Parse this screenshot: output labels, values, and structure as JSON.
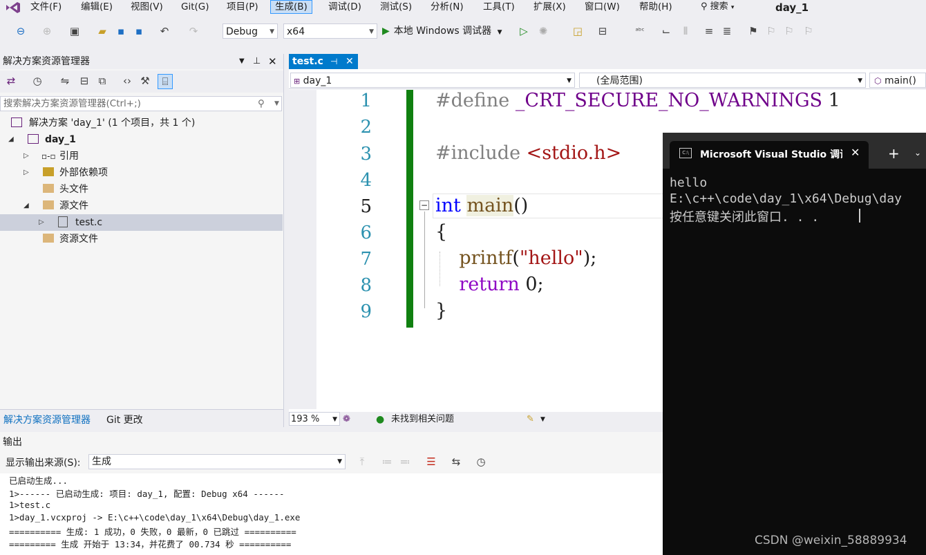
{
  "menu": {
    "items": [
      "文件(F)",
      "编辑(E)",
      "视图(V)",
      "Git(G)",
      "项目(P)",
      "生成(B)",
      "调试(D)",
      "测试(S)",
      "分析(N)",
      "工具(T)",
      "扩展(X)",
      "窗口(W)",
      "帮助(H)"
    ],
    "active_index": 5,
    "search_label": "搜索",
    "title": "day_1"
  },
  "toolbar": {
    "config": "Debug",
    "platform": "x64",
    "run_label": "本地 Windows 调试器"
  },
  "solution_explorer": {
    "title": "解决方案资源管理器",
    "search_placeholder": "搜索解决方案资源管理器(Ctrl+;)",
    "tree": [
      {
        "label": "解决方案 'day_1' (1 个项目，共 1 个)"
      },
      {
        "label": "day_1"
      },
      {
        "label": "引用"
      },
      {
        "label": "外部依赖项"
      },
      {
        "label": "头文件"
      },
      {
        "label": "源文件"
      },
      {
        "label": "test.c"
      },
      {
        "label": "资源文件"
      }
    ],
    "tabs": [
      "解决方案资源管理器",
      "Git 更改"
    ]
  },
  "editor": {
    "tab_label": "test.c",
    "nav": {
      "project": "day_1",
      "scope": "(全局范围)",
      "member": "main()"
    },
    "line_numbers": [
      "1",
      "2",
      "3",
      "4",
      "5",
      "6",
      "7",
      "8",
      "9"
    ],
    "code": {
      "l1_directive": "#define",
      "l1_macro": "_CRT_SECURE_NO_WARNINGS",
      "l1_value": "1",
      "l3_directive": "#include",
      "l3_header": "<stdio.h>",
      "l5_type": "int",
      "l5_name": "main",
      "l5_parens": "()",
      "l6": "{",
      "l7_fn": "printf",
      "l7_open": "(",
      "l7_str": "\"hello\"",
      "l7_close": ");",
      "l8_kw": "return",
      "l8_rest": "0;",
      "l9": "}"
    },
    "zoom": "193 %",
    "status": "未找到相关问题"
  },
  "output": {
    "title": "输出",
    "source_label": "显示输出来源(S):",
    "source_value": "生成",
    "lines": [
      "已启动生成...",
      "1>------ 已启动生成: 项目: day_1, 配置: Debug x64 ------",
      "1>test.c",
      "1>day_1.vcxproj -> E:\\c++\\code\\day_1\\x64\\Debug\\day_1.exe",
      "========== 生成: 1 成功，0 失败，0 最新，0 已跳过 ==========",
      "========= 生成 开始于 13:34，并花费了 00.734 秒 =========="
    ]
  },
  "console": {
    "tab_title": "Microsoft Visual Studio 调试控",
    "lines": [
      "hello",
      "E:\\c++\\code\\day_1\\x64\\Debug\\day",
      "按任意键关闭此窗口. . ."
    ]
  },
  "watermark": "CSDN @weixin_58889934"
}
